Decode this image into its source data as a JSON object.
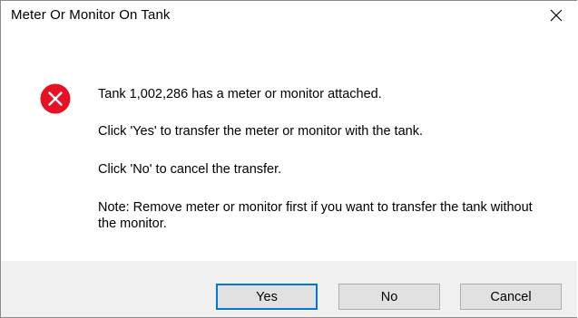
{
  "window": {
    "title": "Meter Or Monitor On Tank",
    "close_icon": "close-icon"
  },
  "icon": {
    "type": "error-icon",
    "color": "#e81123"
  },
  "messages": {
    "line1": "Tank 1,002,286 has a meter or monitor attached.",
    "line2": "Click 'Yes' to transfer the meter or monitor with the tank.",
    "line3": "Click 'No' to cancel the transfer.",
    "line4": "Note: Remove meter or monitor first if you want to transfer the tank without the monitor."
  },
  "buttons": {
    "yes_label": "Yes",
    "no_label": "No",
    "cancel_label": "Cancel"
  },
  "colors": {
    "focus_border": "#0078d7",
    "footer_bg": "#f0f0f0",
    "button_bg": "#e1e1e1"
  }
}
